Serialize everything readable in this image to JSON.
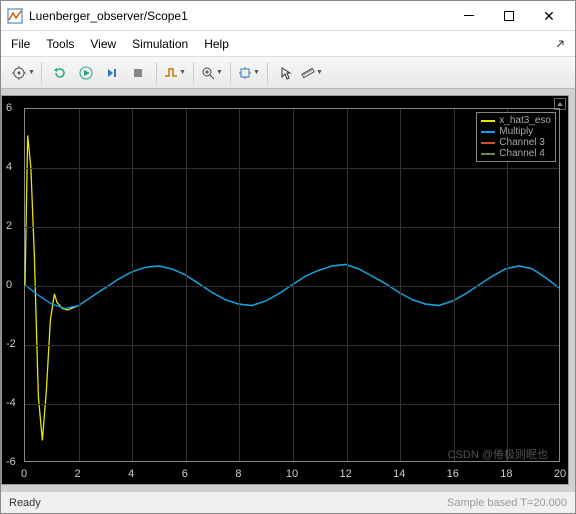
{
  "window": {
    "title": "Luenberger_observer/Scope1"
  },
  "menu": {
    "file": "File",
    "tools": "Tools",
    "view": "View",
    "simulation": "Simulation",
    "help": "Help"
  },
  "status": {
    "ready": "Ready",
    "right": "Sample based  T=20.000"
  },
  "watermark": "CSDN @倦极则眠也",
  "legend": {
    "s1": "x_hat3_eso",
    "s2": "Multiply",
    "s3": "Channel 3",
    "s4": "Channel 4"
  },
  "colors": {
    "s1": "#e6e600",
    "s2": "#00a0ff",
    "s3": "#d05028",
    "s4": "#6a8a5a"
  },
  "chart_data": {
    "type": "line",
    "xlabel": "",
    "ylabel": "",
    "xlim": [
      0,
      20
    ],
    "ylim": [
      -6,
      6
    ],
    "xticks": [
      0,
      2,
      4,
      6,
      8,
      10,
      12,
      14,
      16,
      18,
      20
    ],
    "yticks": [
      -6,
      -4,
      -2,
      0,
      2,
      4,
      6
    ],
    "series": [
      {
        "name": "x_hat3_eso",
        "color": "#e6e600",
        "x": [
          0,
          0.1,
          0.22,
          0.35,
          0.5,
          0.65,
          0.8,
          0.95,
          1.1,
          1.2,
          1.4,
          1.6,
          2,
          2.5,
          3,
          3.5,
          4,
          4.5,
          5,
          5.5,
          6,
          6.5,
          7,
          7.5,
          8,
          8.5,
          9,
          9.5,
          10,
          10.5,
          11,
          11.5,
          12,
          12.5,
          13,
          13.5,
          14,
          14.5,
          15,
          15.5,
          16,
          16.5,
          17,
          17.5,
          18,
          18.5,
          19,
          19.5,
          20
        ],
        "y": [
          0,
          5.1,
          4.0,
          1.0,
          -3.8,
          -5.3,
          -3.6,
          -1.2,
          -0.3,
          -0.6,
          -0.8,
          -0.85,
          -0.7,
          -0.4,
          -0.1,
          0.2,
          0.45,
          0.6,
          0.65,
          0.55,
          0.35,
          0.05,
          -0.25,
          -0.5,
          -0.65,
          -0.7,
          -0.55,
          -0.3,
          0,
          0.3,
          0.5,
          0.65,
          0.7,
          0.55,
          0.3,
          0.05,
          -0.25,
          -0.5,
          -0.65,
          -0.7,
          -0.55,
          -0.3,
          0,
          0.3,
          0.55,
          0.65,
          0.55,
          0.25,
          -0.1
        ]
      },
      {
        "name": "Multiply",
        "color": "#00a0ff",
        "x": [
          0,
          0.5,
          1,
          1.5,
          2,
          2.5,
          3,
          3.5,
          4,
          4.5,
          5,
          5.5,
          6,
          6.5,
          7,
          7.5,
          8,
          8.5,
          9,
          9.5,
          10,
          10.5,
          11,
          11.5,
          12,
          12.5,
          13,
          13.5,
          14,
          14.5,
          15,
          15.5,
          16,
          16.5,
          17,
          17.5,
          18,
          18.5,
          19,
          19.5,
          20
        ],
        "y": [
          0,
          -0.35,
          -0.65,
          -0.8,
          -0.7,
          -0.4,
          -0.1,
          0.2,
          0.45,
          0.6,
          0.65,
          0.55,
          0.35,
          0.05,
          -0.25,
          -0.5,
          -0.65,
          -0.7,
          -0.55,
          -0.3,
          0,
          0.3,
          0.5,
          0.65,
          0.7,
          0.55,
          0.3,
          0.05,
          -0.25,
          -0.5,
          -0.65,
          -0.7,
          -0.55,
          -0.3,
          0,
          0.3,
          0.55,
          0.65,
          0.55,
          0.25,
          -0.1
        ]
      }
    ]
  }
}
